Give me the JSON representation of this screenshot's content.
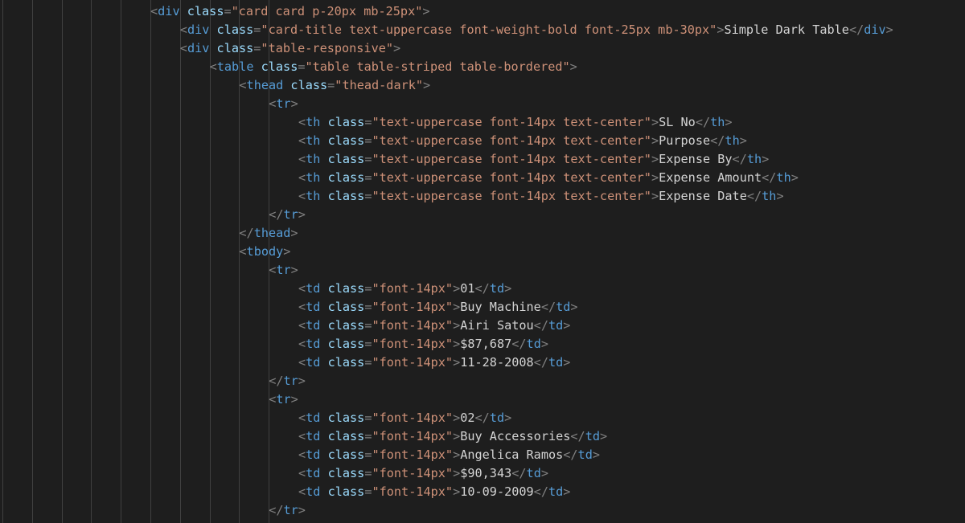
{
  "editor": {
    "theme": {
      "background": "#1e1e1e",
      "punctuation": "#808080",
      "tag": "#569cd6",
      "attribute": "#9cdcfe",
      "string": "#ce9178",
      "text": "#d4d4d4",
      "indent_guide": "#404040"
    },
    "lines": [
      {
        "indent": 5,
        "tokens": [
          [
            "punct",
            "<"
          ],
          [
            "tag",
            "div"
          ],
          [
            "text",
            " "
          ],
          [
            "attr",
            "class"
          ],
          [
            "punct",
            "="
          ],
          [
            "str",
            "\"card card p-20px mb-25px\""
          ],
          [
            "punct",
            ">"
          ]
        ]
      },
      {
        "indent": 6,
        "tokens": [
          [
            "punct",
            "<"
          ],
          [
            "tag",
            "div"
          ],
          [
            "text",
            " "
          ],
          [
            "attr",
            "class"
          ],
          [
            "punct",
            "="
          ],
          [
            "str",
            "\"card-title text-uppercase font-weight-bold font-25px mb-30px\""
          ],
          [
            "punct",
            ">"
          ],
          [
            "text",
            "Simple Dark Table"
          ],
          [
            "punct",
            "</"
          ],
          [
            "tag",
            "div"
          ],
          [
            "punct",
            ">"
          ]
        ]
      },
      {
        "indent": 6,
        "tokens": [
          [
            "punct",
            "<"
          ],
          [
            "tag",
            "div"
          ],
          [
            "text",
            " "
          ],
          [
            "attr",
            "class"
          ],
          [
            "punct",
            "="
          ],
          [
            "str",
            "\"table-responsive\""
          ],
          [
            "punct",
            ">"
          ]
        ]
      },
      {
        "indent": 7,
        "tokens": [
          [
            "punct",
            "<"
          ],
          [
            "tag",
            "table"
          ],
          [
            "text",
            " "
          ],
          [
            "attr",
            "class"
          ],
          [
            "punct",
            "="
          ],
          [
            "str",
            "\"table table-striped table-bordered\""
          ],
          [
            "punct",
            ">"
          ]
        ]
      },
      {
        "indent": 8,
        "tokens": [
          [
            "punct",
            "<"
          ],
          [
            "tag",
            "thead"
          ],
          [
            "text",
            " "
          ],
          [
            "attr",
            "class"
          ],
          [
            "punct",
            "="
          ],
          [
            "str",
            "\"thead-dark\""
          ],
          [
            "punct",
            ">"
          ]
        ]
      },
      {
        "indent": 9,
        "tokens": [
          [
            "punct",
            "<"
          ],
          [
            "tag",
            "tr"
          ],
          [
            "punct",
            ">"
          ]
        ]
      },
      {
        "indent": 10,
        "tokens": [
          [
            "punct",
            "<"
          ],
          [
            "tag",
            "th"
          ],
          [
            "text",
            " "
          ],
          [
            "attr",
            "class"
          ],
          [
            "punct",
            "="
          ],
          [
            "str",
            "\"text-uppercase font-14px text-center\""
          ],
          [
            "punct",
            ">"
          ],
          [
            "text",
            "SL No"
          ],
          [
            "punct",
            "</"
          ],
          [
            "tag",
            "th"
          ],
          [
            "punct",
            ">"
          ]
        ]
      },
      {
        "indent": 10,
        "tokens": [
          [
            "punct",
            "<"
          ],
          [
            "tag",
            "th"
          ],
          [
            "text",
            " "
          ],
          [
            "attr",
            "class"
          ],
          [
            "punct",
            "="
          ],
          [
            "str",
            "\"text-uppercase font-14px text-center\""
          ],
          [
            "punct",
            ">"
          ],
          [
            "text",
            "Purpose"
          ],
          [
            "punct",
            "</"
          ],
          [
            "tag",
            "th"
          ],
          [
            "punct",
            ">"
          ]
        ]
      },
      {
        "indent": 10,
        "tokens": [
          [
            "punct",
            "<"
          ],
          [
            "tag",
            "th"
          ],
          [
            "text",
            " "
          ],
          [
            "attr",
            "class"
          ],
          [
            "punct",
            "="
          ],
          [
            "str",
            "\"text-uppercase font-14px text-center\""
          ],
          [
            "punct",
            ">"
          ],
          [
            "text",
            "Expense By"
          ],
          [
            "punct",
            "</"
          ],
          [
            "tag",
            "th"
          ],
          [
            "punct",
            ">"
          ]
        ]
      },
      {
        "indent": 10,
        "tokens": [
          [
            "punct",
            "<"
          ],
          [
            "tag",
            "th"
          ],
          [
            "text",
            " "
          ],
          [
            "attr",
            "class"
          ],
          [
            "punct",
            "="
          ],
          [
            "str",
            "\"text-uppercase font-14px text-center\""
          ],
          [
            "punct",
            ">"
          ],
          [
            "text",
            "Expense Amount"
          ],
          [
            "punct",
            "</"
          ],
          [
            "tag",
            "th"
          ],
          [
            "punct",
            ">"
          ]
        ]
      },
      {
        "indent": 10,
        "tokens": [
          [
            "punct",
            "<"
          ],
          [
            "tag",
            "th"
          ],
          [
            "text",
            " "
          ],
          [
            "attr",
            "class"
          ],
          [
            "punct",
            "="
          ],
          [
            "str",
            "\"text-uppercase font-14px text-center\""
          ],
          [
            "punct",
            ">"
          ],
          [
            "text",
            "Expense Date"
          ],
          [
            "punct",
            "</"
          ],
          [
            "tag",
            "th"
          ],
          [
            "punct",
            ">"
          ]
        ]
      },
      {
        "indent": 9,
        "tokens": [
          [
            "punct",
            "</"
          ],
          [
            "tag",
            "tr"
          ],
          [
            "punct",
            ">"
          ]
        ]
      },
      {
        "indent": 8,
        "tokens": [
          [
            "punct",
            "</"
          ],
          [
            "tag",
            "thead"
          ],
          [
            "punct",
            ">"
          ]
        ]
      },
      {
        "indent": 8,
        "tokens": [
          [
            "punct",
            "<"
          ],
          [
            "tag",
            "tbody"
          ],
          [
            "punct",
            ">"
          ]
        ]
      },
      {
        "indent": 9,
        "tokens": [
          [
            "punct",
            "<"
          ],
          [
            "tag",
            "tr"
          ],
          [
            "punct",
            ">"
          ]
        ]
      },
      {
        "indent": 10,
        "tokens": [
          [
            "punct",
            "<"
          ],
          [
            "tag",
            "td"
          ],
          [
            "text",
            " "
          ],
          [
            "attr",
            "class"
          ],
          [
            "punct",
            "="
          ],
          [
            "str",
            "\"font-14px\""
          ],
          [
            "punct",
            ">"
          ],
          [
            "text",
            "01"
          ],
          [
            "punct",
            "</"
          ],
          [
            "tag",
            "td"
          ],
          [
            "punct",
            ">"
          ]
        ]
      },
      {
        "indent": 10,
        "tokens": [
          [
            "punct",
            "<"
          ],
          [
            "tag",
            "td"
          ],
          [
            "text",
            " "
          ],
          [
            "attr",
            "class"
          ],
          [
            "punct",
            "="
          ],
          [
            "str",
            "\"font-14px\""
          ],
          [
            "punct",
            ">"
          ],
          [
            "text",
            "Buy Machine"
          ],
          [
            "punct",
            "</"
          ],
          [
            "tag",
            "td"
          ],
          [
            "punct",
            ">"
          ]
        ]
      },
      {
        "indent": 10,
        "tokens": [
          [
            "punct",
            "<"
          ],
          [
            "tag",
            "td"
          ],
          [
            "text",
            " "
          ],
          [
            "attr",
            "class"
          ],
          [
            "punct",
            "="
          ],
          [
            "str",
            "\"font-14px\""
          ],
          [
            "punct",
            ">"
          ],
          [
            "text",
            "Airi Satou"
          ],
          [
            "punct",
            "</"
          ],
          [
            "tag",
            "td"
          ],
          [
            "punct",
            ">"
          ]
        ]
      },
      {
        "indent": 10,
        "tokens": [
          [
            "punct",
            "<"
          ],
          [
            "tag",
            "td"
          ],
          [
            "text",
            " "
          ],
          [
            "attr",
            "class"
          ],
          [
            "punct",
            "="
          ],
          [
            "str",
            "\"font-14px\""
          ],
          [
            "punct",
            ">"
          ],
          [
            "text",
            "$87,687"
          ],
          [
            "punct",
            "</"
          ],
          [
            "tag",
            "td"
          ],
          [
            "punct",
            ">"
          ]
        ]
      },
      {
        "indent": 10,
        "tokens": [
          [
            "punct",
            "<"
          ],
          [
            "tag",
            "td"
          ],
          [
            "text",
            " "
          ],
          [
            "attr",
            "class"
          ],
          [
            "punct",
            "="
          ],
          [
            "str",
            "\"font-14px\""
          ],
          [
            "punct",
            ">"
          ],
          [
            "text",
            "11-28-2008"
          ],
          [
            "punct",
            "</"
          ],
          [
            "tag",
            "td"
          ],
          [
            "punct",
            ">"
          ]
        ]
      },
      {
        "indent": 9,
        "tokens": [
          [
            "punct",
            "</"
          ],
          [
            "tag",
            "tr"
          ],
          [
            "punct",
            ">"
          ]
        ]
      },
      {
        "indent": 9,
        "tokens": [
          [
            "punct",
            "<"
          ],
          [
            "tag",
            "tr"
          ],
          [
            "punct",
            ">"
          ]
        ]
      },
      {
        "indent": 10,
        "tokens": [
          [
            "punct",
            "<"
          ],
          [
            "tag",
            "td"
          ],
          [
            "text",
            " "
          ],
          [
            "attr",
            "class"
          ],
          [
            "punct",
            "="
          ],
          [
            "str",
            "\"font-14px\""
          ],
          [
            "punct",
            ">"
          ],
          [
            "text",
            "02"
          ],
          [
            "punct",
            "</"
          ],
          [
            "tag",
            "td"
          ],
          [
            "punct",
            ">"
          ]
        ]
      },
      {
        "indent": 10,
        "tokens": [
          [
            "punct",
            "<"
          ],
          [
            "tag",
            "td"
          ],
          [
            "text",
            " "
          ],
          [
            "attr",
            "class"
          ],
          [
            "punct",
            "="
          ],
          [
            "str",
            "\"font-14px\""
          ],
          [
            "punct",
            ">"
          ],
          [
            "text",
            "Buy Accessories"
          ],
          [
            "punct",
            "</"
          ],
          [
            "tag",
            "td"
          ],
          [
            "punct",
            ">"
          ]
        ]
      },
      {
        "indent": 10,
        "tokens": [
          [
            "punct",
            "<"
          ],
          [
            "tag",
            "td"
          ],
          [
            "text",
            " "
          ],
          [
            "attr",
            "class"
          ],
          [
            "punct",
            "="
          ],
          [
            "str",
            "\"font-14px\""
          ],
          [
            "punct",
            ">"
          ],
          [
            "text",
            "Angelica Ramos"
          ],
          [
            "punct",
            "</"
          ],
          [
            "tag",
            "td"
          ],
          [
            "punct",
            ">"
          ]
        ]
      },
      {
        "indent": 10,
        "tokens": [
          [
            "punct",
            "<"
          ],
          [
            "tag",
            "td"
          ],
          [
            "text",
            " "
          ],
          [
            "attr",
            "class"
          ],
          [
            "punct",
            "="
          ],
          [
            "str",
            "\"font-14px\""
          ],
          [
            "punct",
            ">"
          ],
          [
            "text",
            "$90,343"
          ],
          [
            "punct",
            "</"
          ],
          [
            "tag",
            "td"
          ],
          [
            "punct",
            ">"
          ]
        ]
      },
      {
        "indent": 10,
        "tokens": [
          [
            "punct",
            "<"
          ],
          [
            "tag",
            "td"
          ],
          [
            "text",
            " "
          ],
          [
            "attr",
            "class"
          ],
          [
            "punct",
            "="
          ],
          [
            "str",
            "\"font-14px\""
          ],
          [
            "punct",
            ">"
          ],
          [
            "text",
            "10-09-2009"
          ],
          [
            "punct",
            "</"
          ],
          [
            "tag",
            "td"
          ],
          [
            "punct",
            ">"
          ]
        ]
      },
      {
        "indent": 9,
        "tokens": [
          [
            "punct",
            "</"
          ],
          [
            "tag",
            "tr"
          ],
          [
            "punct",
            ">"
          ]
        ]
      }
    ]
  }
}
